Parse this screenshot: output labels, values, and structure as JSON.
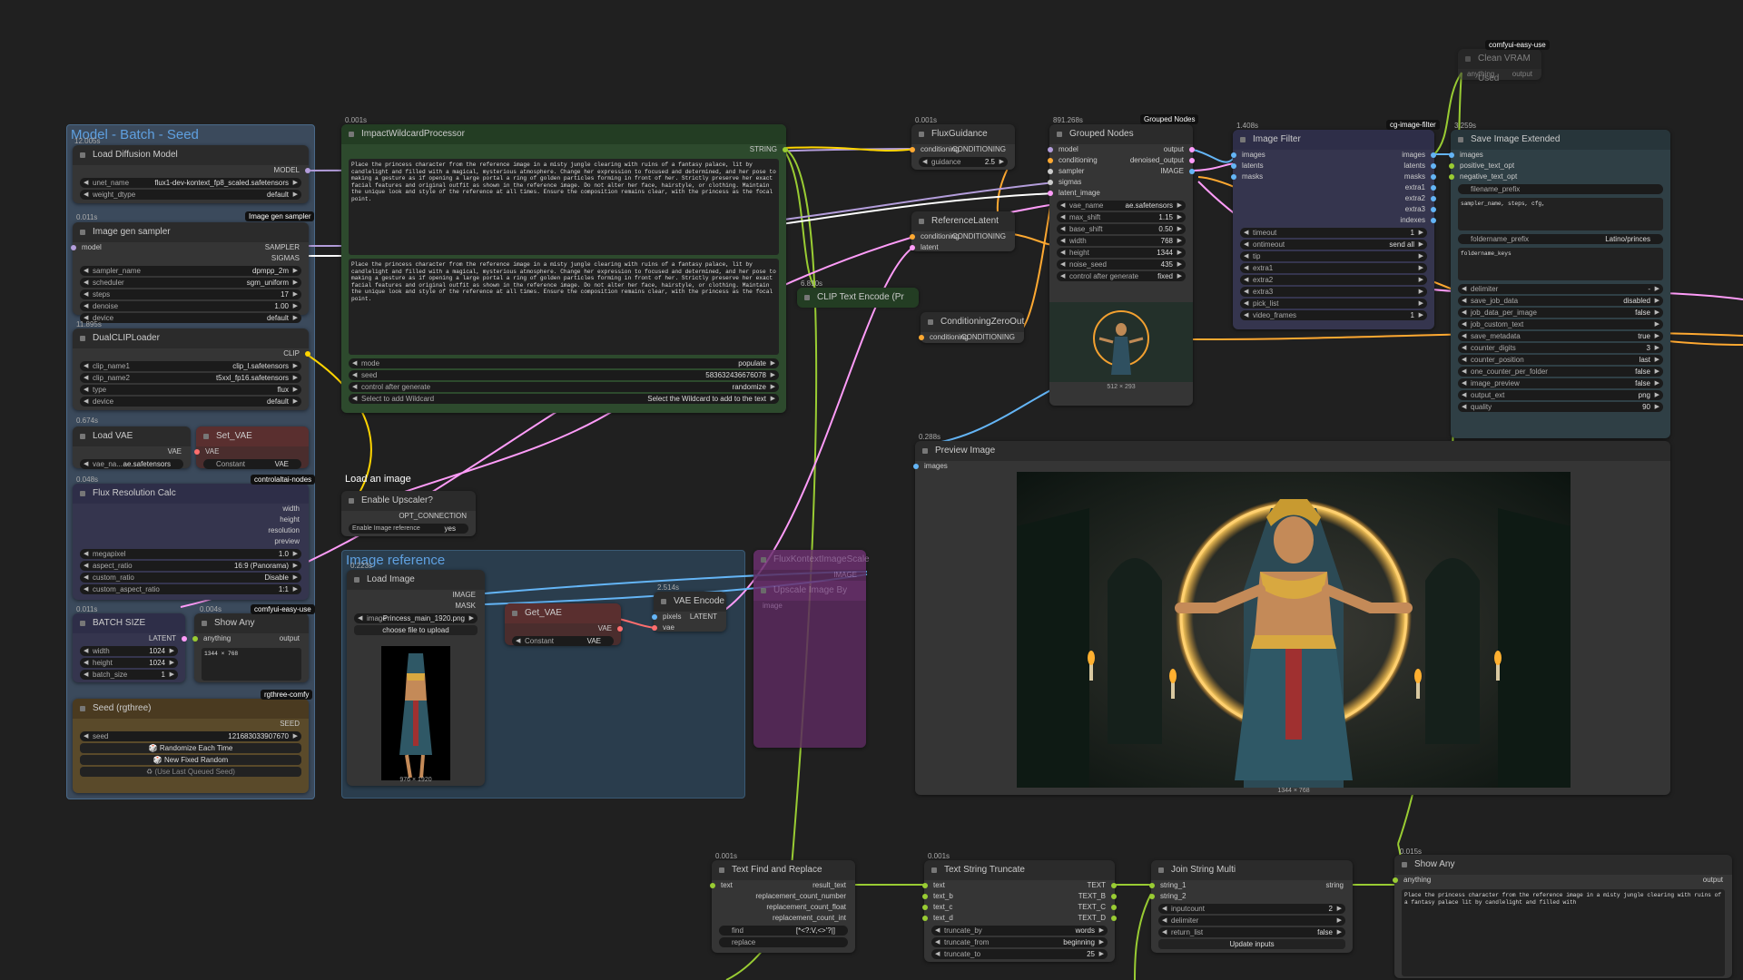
{
  "groups": {
    "model": "Model - Batch - Seed",
    "image_ref": "Image reference",
    "load_label": "Load an image"
  },
  "colors": {
    "bg": "#202020",
    "node": "#353535",
    "string": "#99cc33",
    "model": "#b39ddb",
    "clip": "#ffd500",
    "conditioning": "#ffa931",
    "latent": "#ff9cf9",
    "vae": "#ff6e6e",
    "image": "#64b5f6"
  },
  "nodes": {
    "load_diffusion": {
      "timing": "12.005s",
      "title": "Load Diffusion Model",
      "out": "MODEL",
      "unet_name_label": "unet_name",
      "unet_name": "flux1-dev-kontext_fp8_scaled.safetensors",
      "weight_dtype_label": "weight_dtype",
      "weight_dtype": "default"
    },
    "image_gen": {
      "timing": "0.011s",
      "title": "Image gen sampler",
      "badge": "Image gen sampler",
      "in_model": "model",
      "out_sampler": "SAMPLER",
      "out_sigmas": "SIGMAS",
      "w": [
        [
          "sampler_name",
          "dpmpp_2m"
        ],
        [
          "scheduler",
          "sgm_uniform"
        ],
        [
          "steps",
          "17"
        ],
        [
          "denoise",
          "1.00"
        ],
        [
          "device",
          "default"
        ]
      ]
    },
    "dualclip": {
      "timing": "11.895s",
      "title": "DualCLIPLoader",
      "out": "CLIP",
      "w": [
        [
          "clip_name1",
          "clip_l.safetensors"
        ],
        [
          "clip_name2",
          "t5xxl_fp16.safetensors"
        ],
        [
          "type",
          "flux"
        ],
        [
          "device",
          "default"
        ]
      ]
    },
    "load_vae": {
      "timing": "0.674s",
      "title": "Load VAE",
      "out": "VAE",
      "w_label": "vae_na...",
      "w_val": "ae.safetensors"
    },
    "set_vae": {
      "title": "Set_VAE",
      "in": "VAE",
      "w_label": "Constant",
      "w_val": "VAE",
      "badge": "controlaltai-nodes"
    },
    "flux_res": {
      "timing": "0.048s",
      "title": "Flux Resolution Calc",
      "outs": [
        "width",
        "height",
        "resolution",
        "preview"
      ],
      "w": [
        [
          "megapixel",
          "1.0"
        ],
        [
          "aspect_ratio",
          "16:9 (Panorama)"
        ],
        [
          "custom_ratio",
          "Disable"
        ],
        [
          "custom_aspect_ratio",
          "1:1"
        ]
      ],
      "badge": "comfyui-easy-use"
    },
    "batch": {
      "timing": "0.011s",
      "title": "BATCH SIZE",
      "out": "LATENT",
      "w": [
        [
          "width",
          "1024"
        ],
        [
          "height",
          "1024"
        ],
        [
          "batch_size",
          "1"
        ]
      ]
    },
    "show_any1": {
      "timing": "0.004s",
      "title": "Show Any",
      "in": "anything",
      "out": "output",
      "text": "1344 × 768",
      "badge": "rgthree-comfy"
    },
    "seed": {
      "title": "Seed (rgthree)",
      "out": "SEED",
      "seed_label": "seed",
      "seed_val": "121683033907670",
      "b1": "🎲 Randomize Each Time",
      "b2": "🎲 New Fixed Random",
      "b3": "♻ (Use Last Queued Seed)"
    },
    "wildcard": {
      "timing": "0.001s",
      "title": "ImpactWildcardProcessor",
      "out": "STRING",
      "text1": "Place the princess character from the reference image in a misty jungle clearing with ruins of a fantasy palace, lit by candlelight and filled with a magical, mysterious atmosphere. Change her expression to focused and determined, and her pose to making a gesture as if opening a large portal a ring of golden particles forming in front of her. Strictly preserve her exact facial features and original outfit as shown in the reference image. Do not alter her face, hairstyle, or clothing. Maintain the unique look and style of the reference at all times. Ensure the composition remains clear, with the princess as the focal point.",
      "text2": "Place the princess character from the reference image in a misty jungle clearing with ruins of a fantasy palace, lit by candlelight and filled with a magical, mysterious atmosphere. Change her expression to focused and determined, and her pose to making a gesture as if opening a large portal a ring of golden particles forming in front of her. Strictly preserve her exact facial features and original outfit as shown in the reference image. Do not alter her face, hairstyle, or clothing. Maintain the unique look and style of the reference at all times. Ensure the composition remains clear, with the princess as the focal point.",
      "w": [
        [
          "mode",
          "populate"
        ],
        [
          "seed",
          "583632436676078"
        ],
        [
          "control after generate",
          "randomize"
        ],
        [
          "Select to add Wildcard",
          "Select the Wildcard to add to the text"
        ]
      ]
    },
    "clip_encode": {
      "timing": "6.810s",
      "title": "CLIP Text Encode (Pr"
    },
    "flux_guidance": {
      "timing": "0.001s",
      "title": "FluxGuidance",
      "in": "conditioning",
      "out": "CONDITIONING",
      "w_label": "guidance",
      "w_val": "2.5"
    },
    "ref_latent": {
      "title": "ReferenceLatent",
      "in1": "conditioning",
      "in2": "latent",
      "out": "CONDITIONING"
    },
    "cond_zero": {
      "title": "ConditioningZeroOut",
      "in": "conditioning",
      "out": "CONDITIONING"
    },
    "grouped": {
      "timing": "891.268s",
      "badge": "Grouped Nodes",
      "title": "Grouped Nodes",
      "ins": [
        "model",
        "conditioning",
        "sampler",
        "sigmas",
        "latent_image"
      ],
      "outs": [
        "output",
        "denoised_output",
        "IMAGE"
      ],
      "w": [
        [
          "vae_name",
          "ae.safetensors"
        ],
        [
          "max_shift",
          "1.15"
        ],
        [
          "base_shift",
          "0.50"
        ],
        [
          "width",
          "768"
        ],
        [
          "height",
          "1344"
        ],
        [
          "noise_seed",
          "435"
        ],
        [
          "control after generate",
          "fixed"
        ]
      ],
      "caption": "512 × 293"
    },
    "image_filter": {
      "timing": "1.408s",
      "badge": "cg-image-filter",
      "title": "Image Filter",
      "ins": [
        "images",
        "latents",
        "masks"
      ],
      "outs": [
        "images",
        "latents",
        "masks",
        "extra1",
        "extra2",
        "extra3",
        "indexes"
      ],
      "w": [
        [
          "timeout",
          "1"
        ],
        [
          "ontimeout",
          "send all"
        ],
        [
          "tip",
          ""
        ],
        [
          "extra1",
          ""
        ],
        [
          "extra2",
          ""
        ],
        [
          "extra3",
          ""
        ],
        [
          "pick_list",
          ""
        ],
        [
          "video_frames",
          "1"
        ]
      ]
    },
    "clean_vram": {
      "badge": "comfyui-easy-use",
      "title": "Clean VRAM Used",
      "in": "anything",
      "out": "output"
    },
    "save_image": {
      "timing": "3.259s",
      "title": "Save Image Extended",
      "ins": [
        "images",
        "positive_text_opt",
        "negative_text_opt"
      ],
      "filename_prefix": "filename_prefix",
      "text_a": "sampler_name, steps, cfg,",
      "foldername_prefix": "foldername_prefix",
      "foldername_val": "Latino/princes",
      "text_b": "foldername_keys",
      "w": [
        [
          "delimiter",
          "-"
        ],
        [
          "save_job_data",
          "disabled"
        ],
        [
          "job_data_per_image",
          "false"
        ],
        [
          "job_custom_text",
          ""
        ],
        [
          "save_metadata",
          "true"
        ],
        [
          "counter_digits",
          "3"
        ],
        [
          "counter_position",
          "last"
        ],
        [
          "one_counter_per_folder",
          "false"
        ],
        [
          "image_preview",
          "false"
        ],
        [
          "output_ext",
          "png"
        ],
        [
          "quality",
          "90"
        ]
      ]
    },
    "preview": {
      "timing": "0.288s",
      "title": "Preview Image",
      "in": "images",
      "caption": "1344 × 768"
    },
    "enable_upscaler": {
      "title": "Enable Upscaler?",
      "out": "OPT_CONNECTION",
      "w_label": "Enable Image reference",
      "w_val": "yes"
    },
    "load_image": {
      "timing": "0.223s",
      "title": "Load Image",
      "outs": [
        "IMAGE",
        "MASK"
      ],
      "w_label": "image",
      "w_val": "Princess_main_1920.png",
      "btn": "choose file to upload",
      "caption": "976 × 1920"
    },
    "get_vae": {
      "title": "Get_VAE",
      "out": "VAE",
      "w_label": "Constant",
      "w_val": "VAE"
    },
    "vae_encode": {
      "timing": "2.514s",
      "title": "VAE Encode",
      "ins": [
        "pixels",
        "vae"
      ],
      "out": "LATENT"
    },
    "flux_kontext": {
      "title": "FluxKontextImageScale",
      "out": "IMAGE",
      "title2": "Upscale Image By",
      "in2": "image"
    },
    "text_find": {
      "timing": "0.001s",
      "title": "Text Find and Replace",
      "in": "text",
      "outs": [
        "result_text",
        "replacement_count_number",
        "replacement_count_float",
        "replacement_count_int"
      ],
      "w": [
        [
          "find",
          "[*<?:V,<>'?|]"
        ],
        [
          "replace",
          ""
        ]
      ]
    },
    "text_truncate": {
      "timing": "0.001s",
      "title": "Text String Truncate",
      "ins": [
        "text",
        "text_b",
        "text_c",
        "text_d"
      ],
      "outs": [
        "TEXT",
        "TEXT_B",
        "TEXT_C",
        "TEXT_D"
      ],
      "w": [
        [
          "truncate_by",
          "words"
        ],
        [
          "truncate_from",
          "beginning"
        ],
        [
          "truncate_to",
          "25"
        ]
      ]
    },
    "join_string": {
      "title": "Join String Multi",
      "ins": [
        "string_1",
        "string_2"
      ],
      "out": "string",
      "w": [
        [
          "inputcount",
          "2"
        ],
        [
          "delimiter",
          ""
        ],
        [
          "return_list",
          "false"
        ]
      ],
      "btn": "Update inputs"
    },
    "show_any2": {
      "timing": "0.015s",
      "title": "Show Any",
      "in": "anything",
      "out": "output",
      "text": "Place the princess character from the reference image in a misty jungle clearing with ruins of a fantasy palace lit by candlelight and filled with"
    }
  }
}
